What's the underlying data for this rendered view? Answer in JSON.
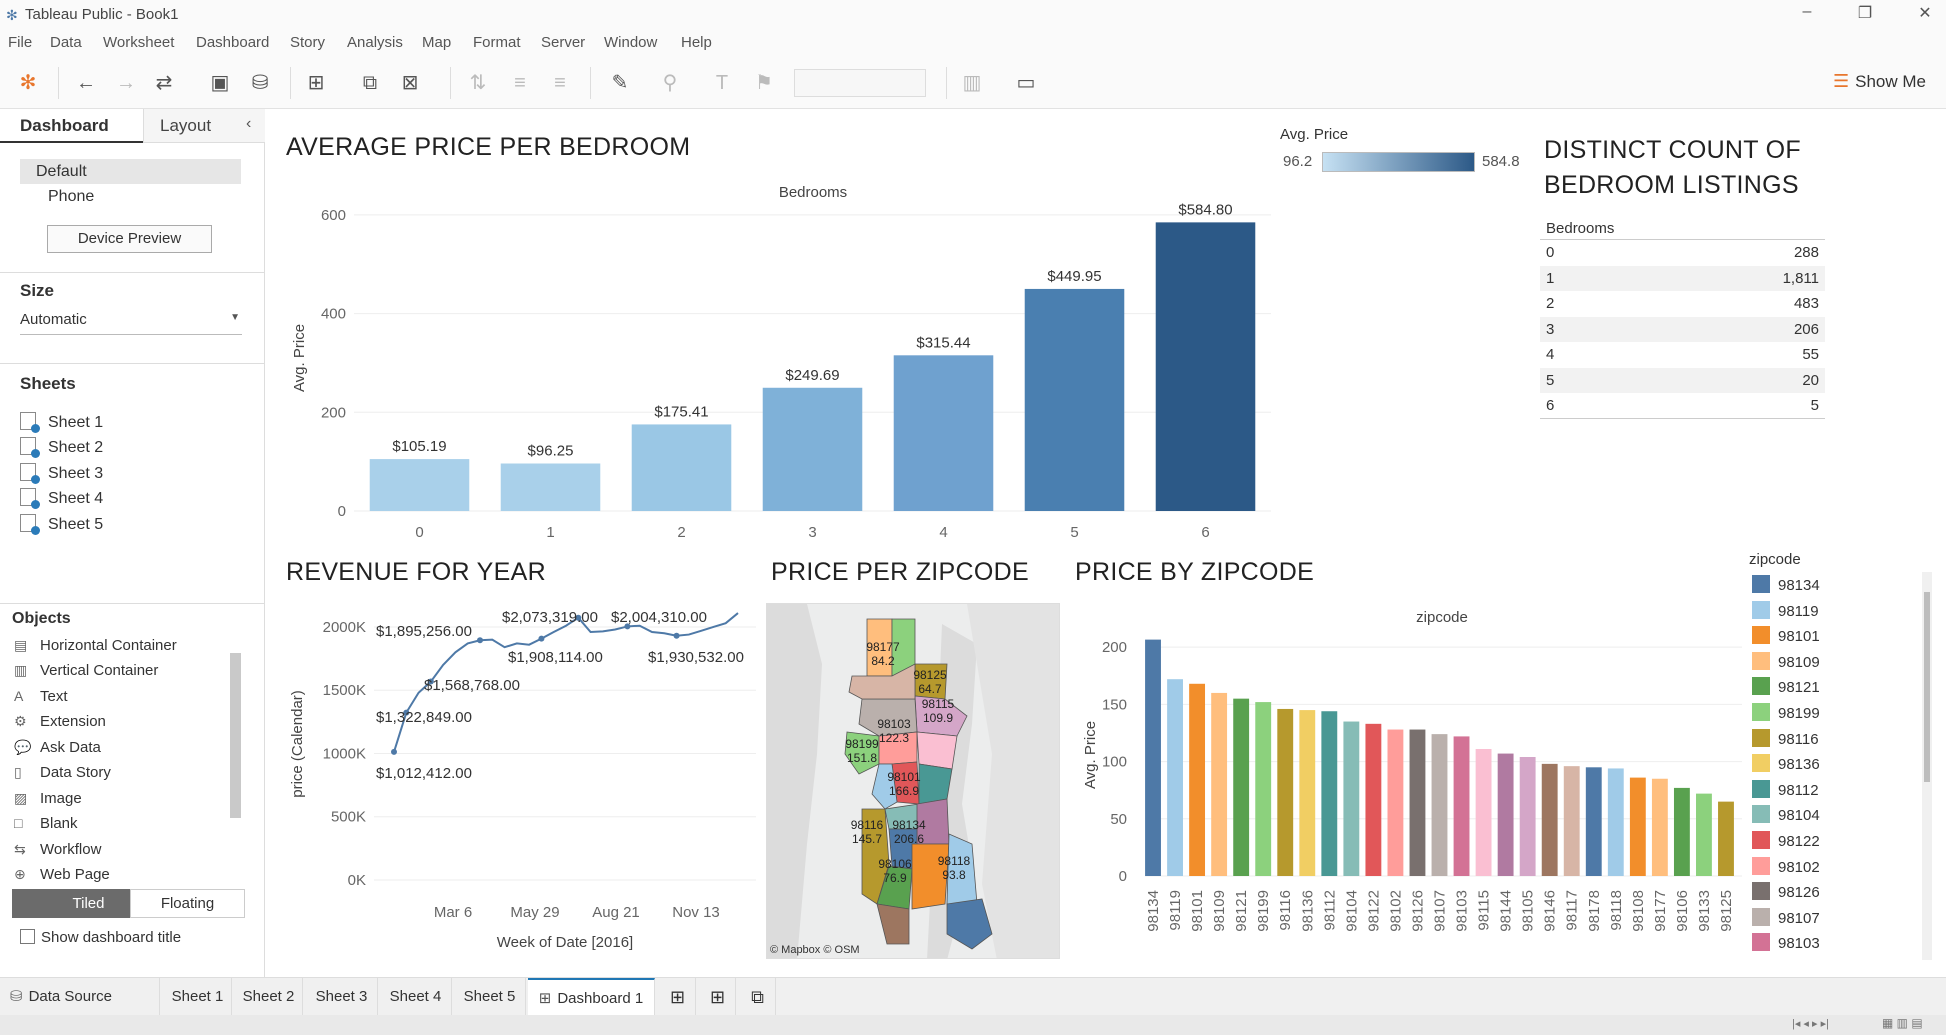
{
  "window": {
    "title": "Tableau Public - Book1",
    "controls": [
      "minimize-icon",
      "restore-icon",
      "close-icon"
    ]
  },
  "menu": [
    "File",
    "Data",
    "Worksheet",
    "Dashboard",
    "Story",
    "Analysis",
    "Map",
    "Format",
    "Server",
    "Window",
    "Help"
  ],
  "toolbar": {
    "show_me": "Show Me"
  },
  "left_panel": {
    "tabs": [
      "Dashboard",
      "Layout"
    ],
    "device_options": [
      "Default",
      "Phone"
    ],
    "device_preview": "Device Preview",
    "size_header": "Size",
    "size_value": "Automatic",
    "sheets_header": "Sheets",
    "sheets": [
      "Sheet 1",
      "Sheet 2",
      "Sheet 3",
      "Sheet 4",
      "Sheet 5"
    ],
    "objects_header": "Objects",
    "objects": [
      {
        "label": "Horizontal Container",
        "icon": "horizontal-container-icon"
      },
      {
        "label": "Vertical Container",
        "icon": "vertical-container-icon"
      },
      {
        "label": "Text",
        "icon": "text-icon"
      },
      {
        "label": "Extension",
        "icon": "extension-icon"
      },
      {
        "label": "Ask Data",
        "icon": "ask-data-icon"
      },
      {
        "label": "Data Story",
        "icon": "data-story-icon"
      },
      {
        "label": "Image",
        "icon": "image-icon"
      },
      {
        "label": "Blank",
        "icon": "blank-icon"
      },
      {
        "label": "Workflow",
        "icon": "workflow-icon"
      },
      {
        "label": "Web Page",
        "icon": "web-page-icon"
      }
    ],
    "tiled": "Tiled",
    "floating": "Floating",
    "show_title": "Show dashboard title"
  },
  "dashboard": {
    "bedroom_title": "AVERAGE PRICE PER BEDROOM",
    "avg_price_legend": {
      "title": "Avg. Price",
      "min": "96.2",
      "max": "584.8"
    },
    "count_title": "DISTINCT COUNT OF BEDROOM LISTINGS",
    "count_header": "Bedrooms",
    "count_rows": [
      {
        "k": "0",
        "v": "288"
      },
      {
        "k": "1",
        "v": "1,811"
      },
      {
        "k": "2",
        "v": "483"
      },
      {
        "k": "3",
        "v": "206"
      },
      {
        "k": "4",
        "v": "55"
      },
      {
        "k": "5",
        "v": "20"
      },
      {
        "k": "6",
        "v": "5"
      }
    ],
    "revenue_title": "REVENUE FOR YEAR",
    "zip_map_title": "PRICE PER ZIPCODE",
    "zip_map_credit": "© Mapbox © OSM",
    "map_labels": [
      {
        "zip": "98177",
        "val": "84.2"
      },
      {
        "zip": "98125",
        "val": "64.7"
      },
      {
        "zip": "98115",
        "val": "109.9"
      },
      {
        "zip": "98103",
        "val": "122.3"
      },
      {
        "zip": "98199",
        "val": "151.8"
      },
      {
        "zip": "98101",
        "val": "166.9"
      },
      {
        "zip": "98116",
        "val": "145.7"
      },
      {
        "zip": "98134",
        "val": "206.6"
      },
      {
        "zip": "98106",
        "val": "76.9"
      },
      {
        "zip": "98118",
        "val": "93.8"
      }
    ],
    "zip_bar_title": "PRICE BY ZIPCODE",
    "zip_legend_title": "zipcode"
  },
  "chart_data": [
    {
      "type": "bar",
      "title": "Bedrooms",
      "xlabel": "",
      "ylabel": "Avg. Price",
      "categories": [
        "0",
        "1",
        "2",
        "3",
        "4",
        "5",
        "6"
      ],
      "values": [
        105.19,
        96.25,
        175.41,
        249.69,
        315.44,
        449.95,
        584.8
      ],
      "data_labels": [
        "$105.19",
        "$96.25",
        "$175.41",
        "$249.69",
        "$315.44",
        "$449.95",
        "$584.80"
      ],
      "colors": [
        "#a9d0ea",
        "#a9d0ea",
        "#9ac7e5",
        "#7fb1d8",
        "#6fa1cf",
        "#4a7fb0",
        "#2c5987"
      ],
      "yticks": [
        "0",
        "200",
        "400",
        "600"
      ],
      "ylim": [
        0,
        620
      ]
    },
    {
      "type": "line",
      "xlabel": "Week of Date [2016]",
      "ylabel": "price (Calendar)",
      "xticks": [
        "Mar 6",
        "May 29",
        "Aug 21",
        "Nov 13"
      ],
      "yticks": [
        "0K",
        "500K",
        "1000K",
        "1500K",
        "2000K"
      ],
      "ylim": [
        0,
        2150000
      ],
      "values": [
        1012412,
        1322849,
        1480000,
        1568768,
        1700000,
        1800000,
        1870000,
        1895256,
        1900000,
        1840000,
        1870000,
        1860000,
        1908114,
        1960000,
        2010000,
        2073319,
        1960000,
        1965000,
        1980000,
        2004310,
        2010000,
        1960000,
        1950000,
        1930532,
        1940000,
        1970000,
        2000000,
        2030000,
        2110000
      ],
      "annotations": [
        "$1,012,412.00",
        "$1,322,849.00",
        "$1,568,768.00",
        "$1,895,256.00",
        "$1,908,114.00",
        "$2,073,319.00",
        "$2,004,310.00",
        "$1,930,532.00"
      ]
    },
    {
      "type": "bar",
      "title": "zipcode",
      "ylabel": "Avg. Price",
      "yticks": [
        "0",
        "50",
        "100",
        "150",
        "200"
      ],
      "ylim": [
        0,
        215
      ],
      "categories": [
        "98134",
        "98119",
        "98101",
        "98109",
        "98121",
        "98199",
        "98116",
        "98136",
        "98112",
        "98104",
        "98122",
        "98102",
        "98126",
        "98107",
        "98103",
        "98115",
        "98144",
        "98105",
        "98146",
        "98117",
        "98178",
        "98118",
        "98108",
        "98177",
        "98106",
        "98133",
        "98125"
      ],
      "values": [
        206.6,
        172,
        168,
        160,
        155,
        152,
        146,
        145,
        144,
        135,
        133,
        128,
        128,
        124,
        122,
        111,
        107,
        104,
        98,
        96,
        95,
        94,
        86,
        85,
        77,
        72,
        65
      ],
      "colors": [
        "#4e79a7",
        "#a0cbe8",
        "#f28e2b",
        "#ffbe7d",
        "#59a14f",
        "#8cd17d",
        "#b6992d",
        "#f1ce63",
        "#499894",
        "#86bcb6",
        "#e15759",
        "#ff9d9a",
        "#79706e",
        "#bab0ac",
        "#d37295",
        "#fabfd2",
        "#b07aa1",
        "#d4a6c8",
        "#9d7660",
        "#d7b5a6",
        "#4e79a7",
        "#a0cbe8",
        "#f28e2b",
        "#ffbe7d",
        "#59a14f",
        "#8cd17d",
        "#b6992d"
      ],
      "legend_visible": [
        "98134",
        "98119",
        "98101",
        "98109",
        "98121",
        "98199",
        "98116",
        "98136",
        "98112",
        "98104",
        "98122",
        "98102",
        "98126",
        "98107",
        "98103"
      ]
    }
  ],
  "bottom_tabs": [
    "Data Source",
    "Sheet 1",
    "Sheet 2",
    "Sheet 3",
    "Sheet 4",
    "Sheet 5",
    "Dashboard 1"
  ]
}
